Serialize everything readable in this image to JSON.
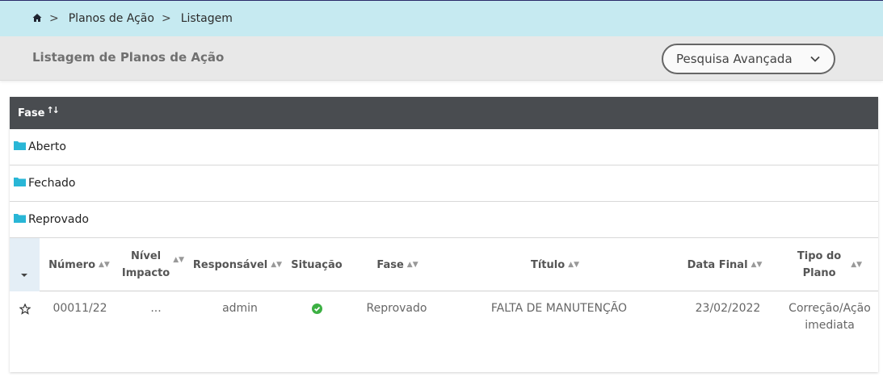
{
  "breadcrumb": {
    "items": [
      "Planos de Ação",
      "Listagem"
    ],
    "separator": ">"
  },
  "page": {
    "title": "Listagem de Planos de Ação",
    "advanced_search_label": "Pesquisa Avançada"
  },
  "grouping": {
    "header_label": "Fase",
    "groups": [
      "Aberto",
      "Fechado",
      "Reprovado"
    ]
  },
  "table": {
    "columns": {
      "numero": "Número",
      "nivel_impacto_1": "Nível",
      "nivel_impacto_2": "Impacto",
      "responsavel": "Responsável",
      "situacao": "Situação",
      "fase": "Fase",
      "titulo": "Título",
      "data_final": "Data Final",
      "tipo_plano_1": "Tipo do",
      "tipo_plano_2": "Plano"
    },
    "rows": [
      {
        "numero": "00011/22",
        "nivel_impacto": "...",
        "responsavel": "admin",
        "situacao_icon": "check-circle-icon",
        "fase": "Reprovado",
        "titulo": "FALTA DE MANUTENÇÃO",
        "data_final": "23/02/2022",
        "tipo_plano_1": "Correção/Ação",
        "tipo_plano_2": "imediata"
      }
    ]
  },
  "colors": {
    "breadcrumb_bg": "#c6eaf1",
    "group_header_bg": "#494c50",
    "folder": "#29b6d6",
    "success": "#3cb043"
  }
}
